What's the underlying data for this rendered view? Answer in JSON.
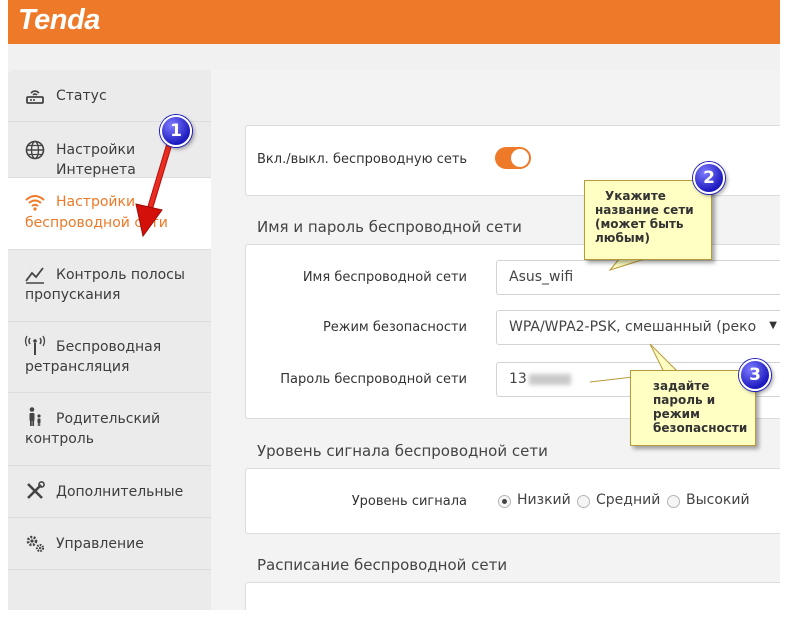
{
  "brand": {
    "logo": "Tenda",
    "accent_color": "#ee7928"
  },
  "sidebar": {
    "items": [
      {
        "label": "Статус",
        "icon": "router-icon",
        "active": false
      },
      {
        "label": "Настройки Интернета",
        "icon": "globe-icon",
        "active": false
      },
      {
        "label_line1": "Настройки",
        "label_line2": "беспроводной сети",
        "icon": "wifi-icon",
        "active": true
      },
      {
        "label_line1": "Контроль полосы",
        "label_line2": "пропускания",
        "icon": "bandwidth-chart-icon",
        "active": false
      },
      {
        "label_line1": "Беспроводная",
        "label_line2": "ретрансляция",
        "icon": "antenna-icon",
        "active": false
      },
      {
        "label_line1": "Родительский",
        "label_line2": "контроль",
        "icon": "parent-child-icon",
        "active": false
      },
      {
        "label": "Дополнительные",
        "icon": "tools-icon",
        "active": false
      },
      {
        "label": "Управление",
        "icon": "gears-icon",
        "active": false
      }
    ]
  },
  "wifi_toggle": {
    "label": "Вкл./выкл. беспроводную сеть",
    "enabled": true
  },
  "name_password": {
    "title": "Имя и пароль беспроводной сети",
    "ssid_label": "Имя беспроводной сети",
    "ssid_value": "Asus_wifi",
    "security_label": "Режим безопасности",
    "security_value": "WPA/WPA2-PSK, смешанный (реко",
    "password_label": "Пароль беспроводной сети",
    "password_value": "13"
  },
  "signal": {
    "title": "Уровень сигнала беспроводной сети",
    "label": "Уровень сигнала",
    "options": [
      "Низкий",
      "Средний",
      "Высокий"
    ],
    "selected": "Низкий"
  },
  "schedule": {
    "title": "Расписание беспроводной сети"
  },
  "annotations": {
    "badge1": "1",
    "badge2": "2",
    "badge3": "3",
    "callout2": [
      "Укажите",
      "название сети",
      "(может быть",
      "любым)"
    ],
    "callout3": [
      "задайте",
      "пароль и",
      "режим",
      "безопасности"
    ]
  }
}
